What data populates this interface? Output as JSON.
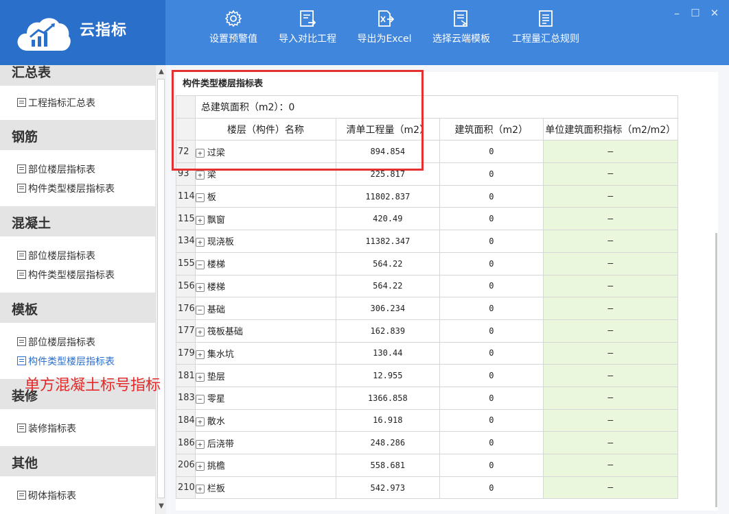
{
  "app": {
    "title": "云指标"
  },
  "toolbar": {
    "set_alert": "设置预警值",
    "import_compare": "导入对比工程",
    "export_excel": "导出为Excel",
    "select_template": "选择云端模板",
    "summary_rules": "工程量汇总规则"
  },
  "window": {
    "minimize": "–",
    "maximize": "□",
    "close": "✕"
  },
  "sidebar": {
    "cat_summary": "汇总表",
    "summary_items": [
      "工程指标汇总表"
    ],
    "cat_rebar": "钢筋",
    "rebar_items": [
      "部位楼层指标表",
      "构件类型楼层指标表"
    ],
    "cat_concrete": "混凝土",
    "concrete_items": [
      "部位楼层指标表",
      "构件类型楼层指标表"
    ],
    "cat_formwork": "模板",
    "formwork_items": [
      "部位楼层指标表",
      "构件类型楼层指标表"
    ],
    "cat_decoration": "装修",
    "decoration_items": [
      "装修指标表"
    ],
    "cat_other": "其他",
    "other_items": [
      "砌体指标表"
    ]
  },
  "panel": {
    "title": "构件类型楼层指标表",
    "total_area": "总建筑面积（m2）：0"
  },
  "table": {
    "headers": [
      "楼层（构件）名称",
      "清单工程量（m2）",
      "建筑面积（m2）",
      "单位建筑面积指标（m2/m2）"
    ],
    "rows": [
      {
        "num": "72",
        "toggle": "+",
        "name": "过梁",
        "qty": "894.854",
        "area": "0",
        "idx": "–"
      },
      {
        "num": "93",
        "toggle": "+",
        "name": "梁",
        "qty": "225.817",
        "area": "0",
        "idx": "–"
      },
      {
        "num": "114",
        "toggle": "−",
        "name": "板",
        "qty": "11802.837",
        "area": "0",
        "idx": "–"
      },
      {
        "num": "115",
        "toggle": "+",
        "name": "飘窗",
        "qty": "420.49",
        "area": "0",
        "idx": "–"
      },
      {
        "num": "134",
        "toggle": "+",
        "name": "现浇板",
        "qty": "11382.347",
        "area": "0",
        "idx": "–"
      },
      {
        "num": "155",
        "toggle": "−",
        "name": "楼梯",
        "qty": "564.22",
        "area": "0",
        "idx": "–"
      },
      {
        "num": "156",
        "toggle": "+",
        "name": "楼梯",
        "qty": "564.22",
        "area": "0",
        "idx": "–"
      },
      {
        "num": "176",
        "toggle": "−",
        "name": "基础",
        "qty": "306.234",
        "area": "0",
        "idx": "–"
      },
      {
        "num": "177",
        "toggle": "+",
        "name": "筏板基础",
        "qty": "162.839",
        "area": "0",
        "idx": "–"
      },
      {
        "num": "179",
        "toggle": "+",
        "name": "集水坑",
        "qty": "130.44",
        "area": "0",
        "idx": "–"
      },
      {
        "num": "181",
        "toggle": "+",
        "name": "垫层",
        "qty": "12.955",
        "area": "0",
        "idx": "–"
      },
      {
        "num": "183",
        "toggle": "−",
        "name": "零星",
        "qty": "1366.858",
        "area": "0",
        "idx": "–"
      },
      {
        "num": "184",
        "toggle": "+",
        "name": "散水",
        "qty": "16.918",
        "area": "0",
        "idx": "–"
      },
      {
        "num": "186",
        "toggle": "+",
        "name": "后浇带",
        "qty": "248.286",
        "area": "0",
        "idx": "–"
      },
      {
        "num": "206",
        "toggle": "+",
        "name": "挑檐",
        "qty": "558.681",
        "area": "0",
        "idx": "–"
      },
      {
        "num": "210",
        "toggle": "+",
        "name": "栏板",
        "qty": "542.973",
        "area": "0",
        "idx": "–"
      }
    ]
  },
  "annotation": {
    "text": "单方混凝土标号指标"
  },
  "colors": {
    "header_bg": "#3f86dc",
    "logo_bg": "#2a6fca",
    "highlight": "#e53030",
    "index_cell_bg": "#eaf7dd",
    "active_link": "#2a6fd0"
  },
  "icons": [
    "cloud-chart-logo",
    "gear-icon",
    "import-icon",
    "export-excel-icon",
    "template-icon",
    "rules-icon"
  ]
}
